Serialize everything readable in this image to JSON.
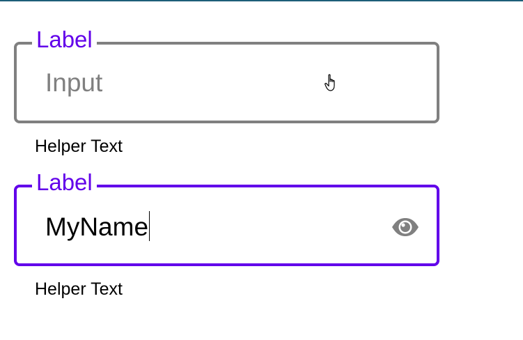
{
  "fields": [
    {
      "label": "Label",
      "placeholder": "Input",
      "value": "",
      "helper": "Helper Text",
      "state": "default"
    },
    {
      "label": "Label",
      "placeholder": "",
      "value": "MyName",
      "helper": "Helper Text",
      "state": "focused",
      "trailing_icon": "eye-icon"
    }
  ],
  "colors": {
    "accent": "#6200ea",
    "border_default": "#808080",
    "placeholder": "#808080",
    "icon": "#808080",
    "top_rule": "#1d5e78"
  },
  "pointer": "hand-pointer-icon"
}
